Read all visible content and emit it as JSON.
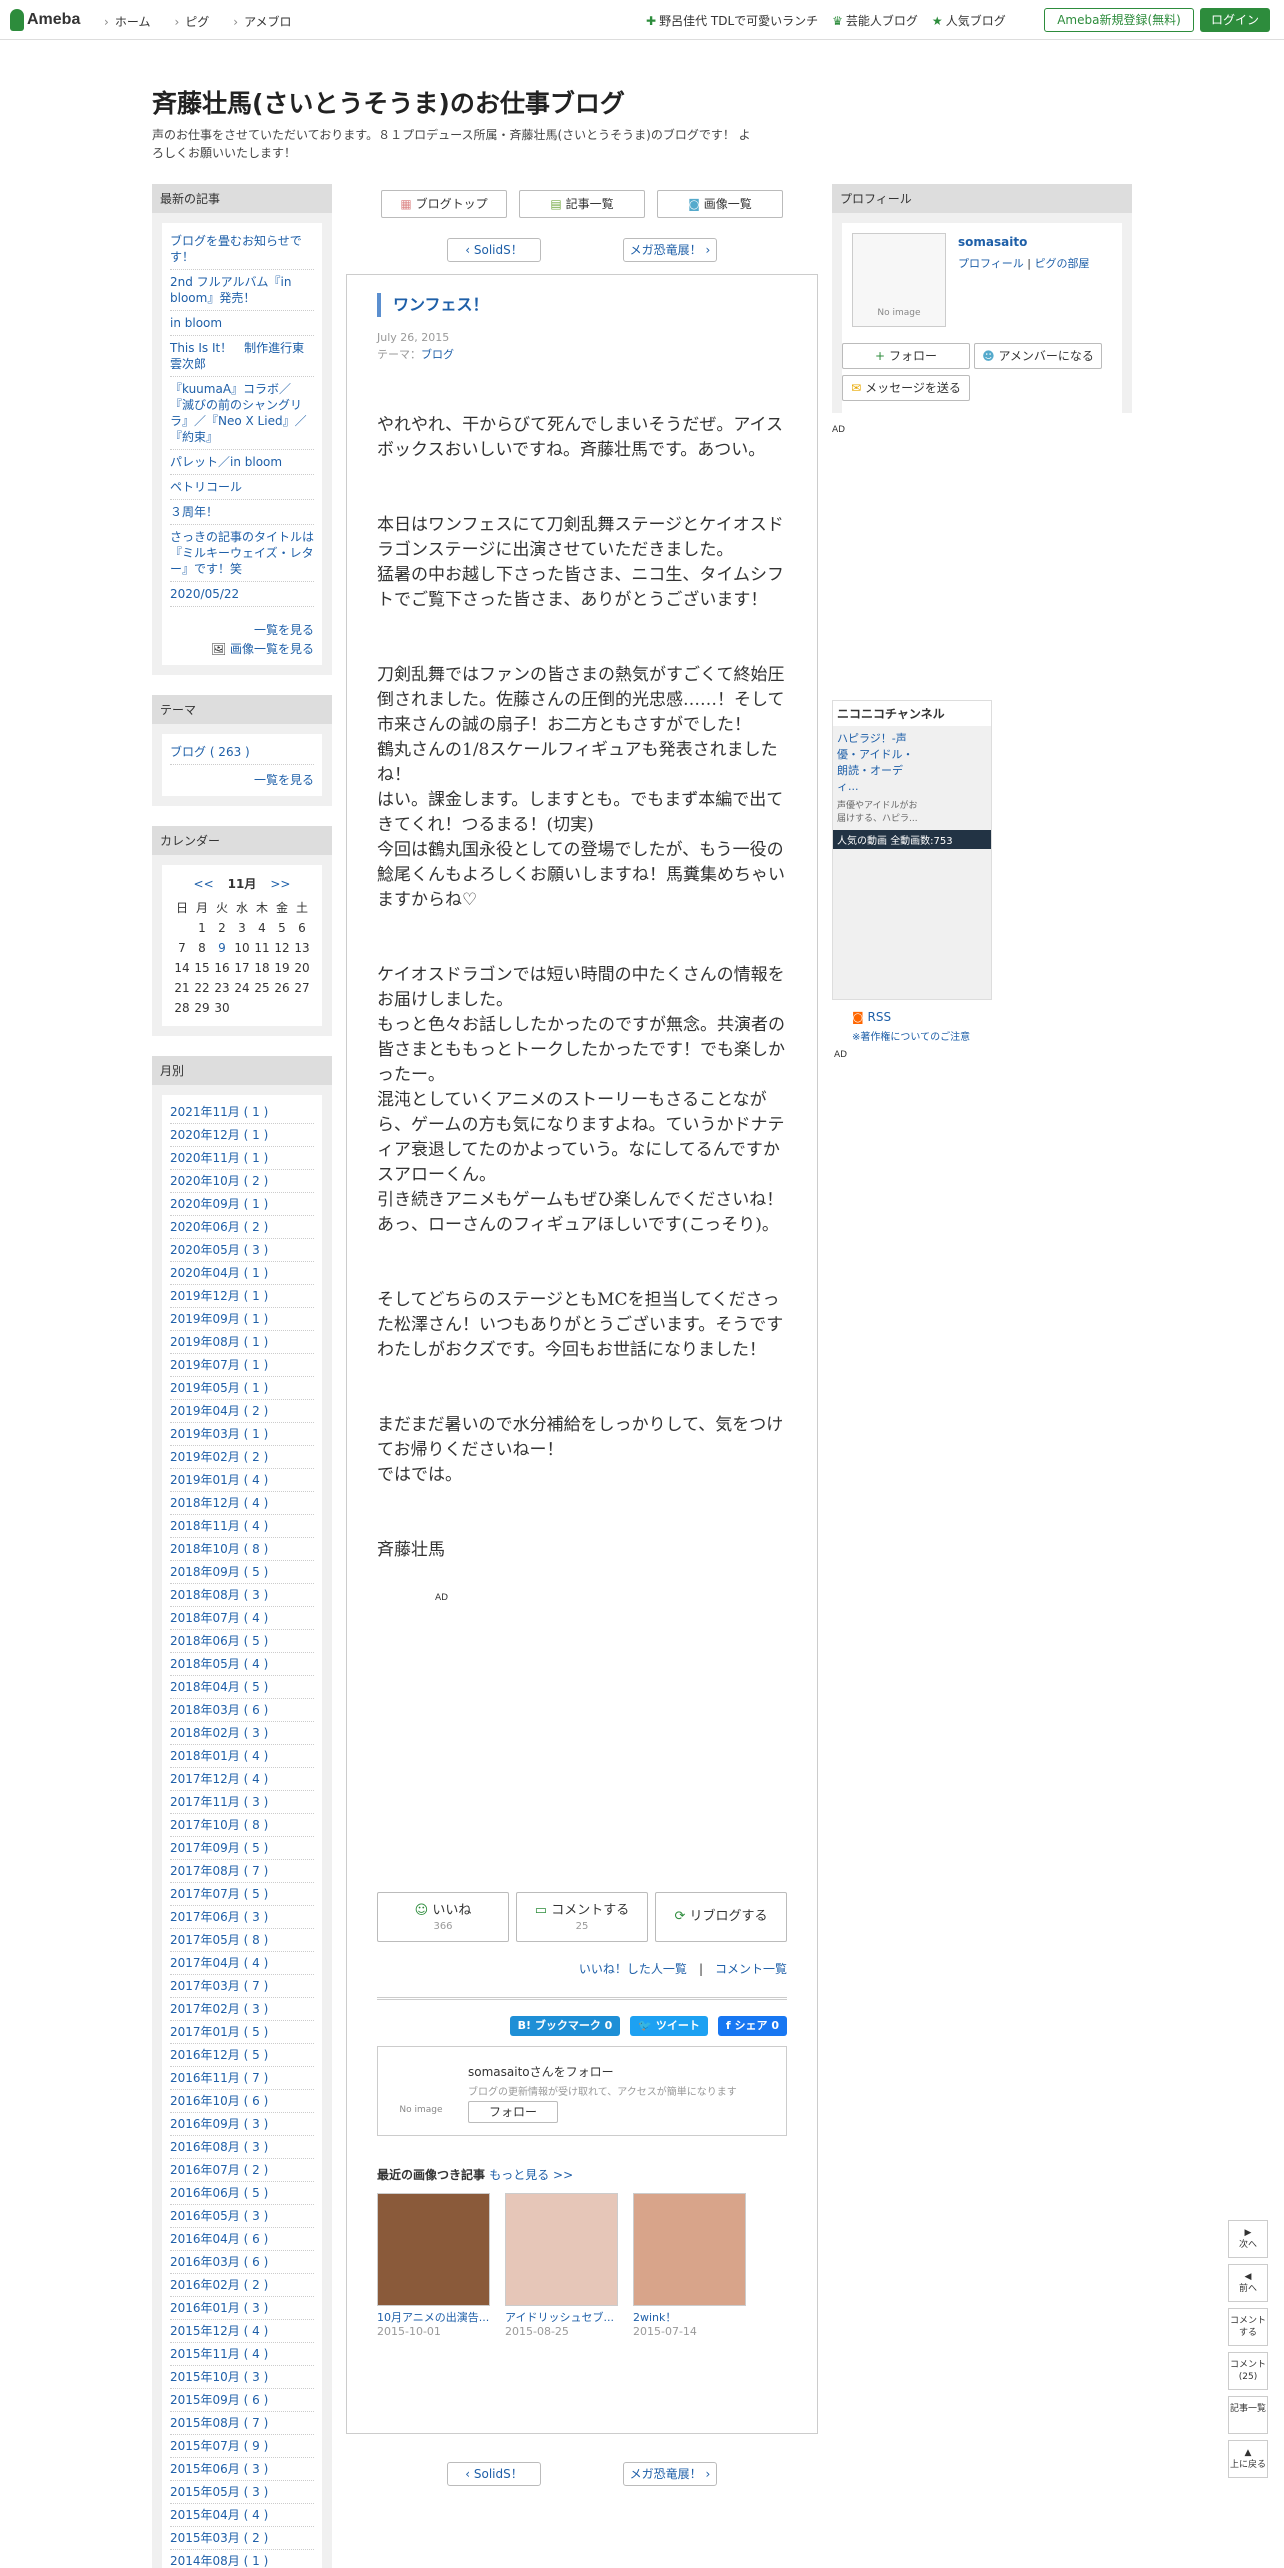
{
  "topbar": {
    "logo": "Ameba",
    "nav": [
      "ホーム",
      "ピグ",
      "アメブロ"
    ],
    "links": [
      "野呂佳代 TDLで可愛いランチ",
      "芸能人ブログ",
      "人気ブログ"
    ],
    "register": "Ameba新規登録(無料)",
    "login": "ログイン"
  },
  "blog": {
    "title": "斉藤壮馬(さいとうそうま)のお仕事ブログ",
    "desc": "声のお仕事をさせていただいております。８１プロデュース所属・斉藤壮馬(さいとうそうま)のブログです！ よろしくお願いいたします！"
  },
  "tabs": [
    "ブログトップ",
    "記事一覧",
    "画像一覧"
  ],
  "pager": {
    "prev": "SolidS！",
    "next": "メガ恐竜展！"
  },
  "article": {
    "title": "ワンフェス！",
    "date": "July 26, 2015",
    "theme_label": "テーマ：",
    "theme": "ブログ",
    "paragraphs": [
      "やれやれ、干からびて死んでしまいそうだぜ。アイスボックスおいしいですね。斉藤壮馬です。あつい。",
      "本日はワンフェスにて刀剣乱舞ステージとケイオスドラゴンステージに出演させていただきました。\n猛暑の中お越し下さった皆さま、ニコ生、タイムシフトでご覧下さった皆さま、ありがとうございます！",
      "刀剣乱舞ではファンの皆さまの熱気がすごくて終始圧倒されました。佐藤さんの圧倒的光忠感……！そして市来さんの誠の扇子！お二方ともさすがでした！\n鶴丸さんの1/8スケールフィギュアも発表されましたね！\nはい。課金します。しますとも。でもまず本編で出てきてくれ！つるまる！(切実)\n今回は鶴丸国永役としての登場でしたが、もう一役の鯰尾くんもよろしくお願いしますね！馬糞集めちゃいますからね♡",
      "ケイオスドラゴンでは短い時間の中たくさんの情報をお届けしました。\nもっと色々お話ししたかったのですが無念。共演者の皆さまとももっとトークしたかったです！でも楽しかったー。\n混沌としていくアニメのストーリーもさることながら、ゲームの方も気になりますよね。ていうかドナティア衰退してたのかよっていう。なにしてるんですかスアローくん。\n引き続きアニメもゲームもぜひ楽しんでくださいね！あっ、ローさんのフィギュアほしいです(こっそり)。",
      "そしてどちらのステージともMCを担当してくださった松澤さん！いつもありがとうございます。そうですわたしがおクズです。今回もお世話になりました！",
      "まだまだ暑いので水分補給をしっかりして、気をつけてお帰りくださいねー！\nではでは。",
      "斉藤壮馬"
    ],
    "ad": "AD",
    "actions": {
      "like": "いいね",
      "like_count": "366",
      "comment": "コメントする",
      "comment_count": "25",
      "reblog": "リブログする"
    },
    "like_users": "いいね！した人一覧",
    "comment_list": "コメント一覧",
    "share": {
      "hatena": "B! ブックマーク 0",
      "tweet": "ツイート",
      "fb": "シェア 0"
    },
    "follow": {
      "name": "somasaitoさんをフォロー",
      "desc": "ブログの更新情報が受け取れて、アクセスが簡単になります",
      "btn": "フォロー",
      "noimage": "No image"
    },
    "recent_title": "最近の画像つき記事",
    "recent_more": "もっと見る >>",
    "recent": [
      {
        "c": "10月アニメの出演告...",
        "d": "2015-10-01"
      },
      {
        "c": "アイドリッシュセブ...",
        "d": "2015-08-25"
      },
      {
        "c": "2wink！",
        "d": "2015-07-14"
      }
    ]
  },
  "left": {
    "recent_title": "最新の記事",
    "recent": [
      "ブログを畳むお知らせです！",
      "2nd フルアルバム『in bloom』発売！",
      "in bloom",
      "This Is It！　制作進行東雲次郎",
      "『kuumaA』コラボ／『滅びの前のシャングリラ』／『Neo X Lied』／『約束』",
      "パレット／in bloom",
      "ペトリコール",
      "３周年！",
      "さっきの記事のタイトルは『ミルキーウェイズ・レター』です！笑",
      "2020/05/22"
    ],
    "recent_more": "一覧を見る",
    "recent_img": "画像一覧を見る",
    "theme_title": "テーマ",
    "theme_item": "ブログ ( 263 )",
    "theme_more": "一覧を見る",
    "cal_title": "カレンダー",
    "cal_prev": "<<",
    "cal_month": "11月",
    "cal_next": ">>",
    "cal_rows": [
      [
        "日",
        "月",
        "火",
        "水",
        "木",
        "金",
        "土"
      ],
      [
        "",
        "1",
        "2",
        "3",
        "4",
        "5",
        "6"
      ],
      [
        "7",
        "8",
        "9",
        "10",
        "11",
        "12",
        "13"
      ],
      [
        "14",
        "15",
        "16",
        "17",
        "18",
        "19",
        "20"
      ],
      [
        "21",
        "22",
        "23",
        "24",
        "25",
        "26",
        "27"
      ],
      [
        "28",
        "29",
        "30",
        "",
        "",
        "",
        ""
      ]
    ],
    "month_title": "月別",
    "months": [
      "2021年11月 ( 1 )",
      "2020年12月 ( 1 )",
      "2020年11月 ( 1 )",
      "2020年10月 ( 2 )",
      "2020年09月 ( 1 )",
      "2020年06月 ( 2 )",
      "2020年05月 ( 3 )",
      "2020年04月 ( 1 )",
      "2019年12月 ( 1 )",
      "2019年09月 ( 1 )",
      "2019年08月 ( 1 )",
      "2019年07月 ( 1 )",
      "2019年05月 ( 1 )",
      "2019年04月 ( 2 )",
      "2019年03月 ( 1 )",
      "2019年02月 ( 2 )",
      "2019年01月 ( 4 )",
      "2018年12月 ( 4 )",
      "2018年11月 ( 4 )",
      "2018年10月 ( 8 )",
      "2018年09月 ( 5 )",
      "2018年08月 ( 3 )",
      "2018年07月 ( 4 )",
      "2018年06月 ( 5 )",
      "2018年05月 ( 4 )",
      "2018年04月 ( 5 )",
      "2018年03月 ( 6 )",
      "2018年02月 ( 3 )",
      "2018年01月 ( 4 )",
      "2017年12月 ( 4 )",
      "2017年11月 ( 3 )",
      "2017年10月 ( 8 )",
      "2017年09月 ( 5 )",
      "2017年08月 ( 7 )",
      "2017年07月 ( 5 )",
      "2017年06月 ( 3 )",
      "2017年05月 ( 8 )",
      "2017年04月 ( 4 )",
      "2017年03月 ( 7 )",
      "2017年02月 ( 3 )",
      "2017年01月 ( 5 )",
      "2016年12月 ( 5 )",
      "2016年11月 ( 7 )",
      "2016年10月 ( 6 )",
      "2016年09月 ( 3 )",
      "2016年08月 ( 3 )",
      "2016年07月 ( 2 )",
      "2016年06月 ( 5 )",
      "2016年05月 ( 3 )",
      "2016年04月 ( 6 )",
      "2016年03月 ( 6 )",
      "2016年02月 ( 2 )",
      "2016年01月 ( 3 )",
      "2015年12月 ( 4 )",
      "2015年11月 ( 4 )",
      "2015年10月 ( 3 )",
      "2015年09月 ( 6 )",
      "2015年08月 ( 7 )",
      "2015年07月 ( 9 )",
      "2015年06月 ( 3 )",
      "2015年05月 ( 3 )",
      "2015年04月 ( 4 )",
      "2015年03月 ( 2 )",
      "2014年08月 ( 1 )",
      "2014年07月 ( 2 )",
      "2014年06月 ( 2 )"
    ]
  },
  "right": {
    "profile_title": "プロフィール",
    "name": "somasaito",
    "profile_link": "プロフィール",
    "pig_link": "ピグの部屋",
    "noimage": "No image",
    "follow": "フォロー",
    "member": "アメンバーになる",
    "message": "メッセージを送る",
    "ad": "AD",
    "nico_title": "ニコニコチャンネル",
    "nico_item": "ハピラジ！-声優・アイドル・朗読・オーディ...",
    "nico_desc": "声優やアイドルがお届けする、ハピラ...",
    "nico_popular": "人気の動画",
    "nico_count": "全動画数:753",
    "rss": "RSS",
    "copyright": "※著作権についてのご注意",
    "ad2": "AD"
  },
  "float": [
    "次へ",
    "前へ",
    "コメントする",
    "コメント(25)",
    "記事一覧",
    "上に戻る"
  ]
}
